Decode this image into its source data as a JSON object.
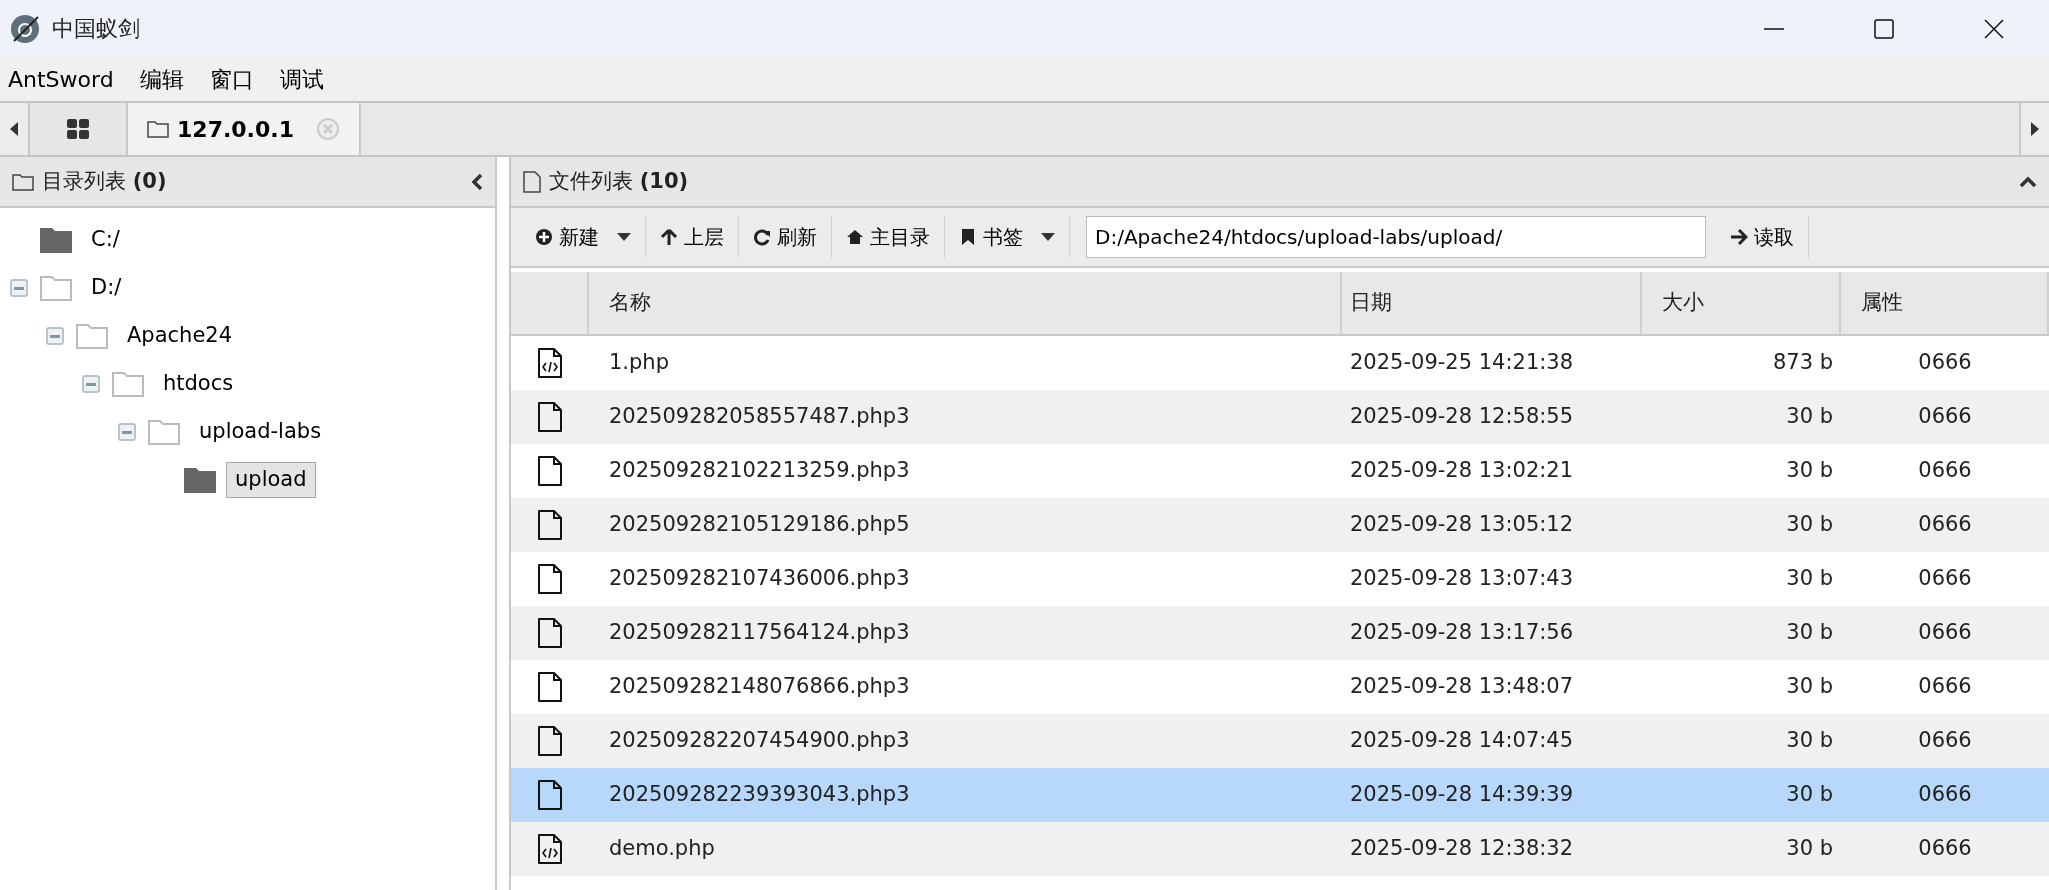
{
  "window": {
    "title": "中国蚁剑"
  },
  "menu": [
    "AntSword",
    "编辑",
    "窗口",
    "调试"
  ],
  "tabs": [
    {
      "kind": "home",
      "selected": false
    },
    {
      "kind": "folder",
      "label": "127.0.0.1",
      "selected": true
    }
  ],
  "dir_panel": {
    "title": "目录列表",
    "count": "(0)",
    "tree": [
      {
        "label": "C:/",
        "expanded": false,
        "selected": false
      },
      {
        "label": "D:/",
        "expanded": true,
        "selected": false,
        "children": [
          {
            "label": "Apache24",
            "expanded": true,
            "selected": false,
            "children": [
              {
                "label": "htdocs",
                "expanded": true,
                "selected": false,
                "children": [
                  {
                    "label": "upload-labs",
                    "expanded": true,
                    "selected": false,
                    "children": [
                      {
                        "label": "upload",
                        "expanded": false,
                        "selected": true
                      }
                    ]
                  }
                ]
              }
            ]
          }
        ]
      }
    ]
  },
  "file_panel": {
    "title": "文件列表",
    "count": "(10)",
    "toolbar": [
      {
        "kind": "new",
        "label": "新建",
        "dropdown": true
      },
      {
        "kind": "up",
        "label": "上层",
        "dropdown": false
      },
      {
        "kind": "refresh",
        "label": "刷新",
        "dropdown": false
      },
      {
        "kind": "home",
        "label": "主目录",
        "dropdown": false
      },
      {
        "kind": "bookmark",
        "label": "书签",
        "dropdown": true
      }
    ],
    "path": "D:/Apache24/htdocs/upload-labs/upload/",
    "read_button": "读取",
    "columns": [
      "名称",
      "日期",
      "大小",
      "属性"
    ],
    "rows": [
      {
        "kind": "code",
        "name": "1.php",
        "date": "2025-09-25 14:21:38",
        "size": "873 b",
        "attr": "0666",
        "selected": false
      },
      {
        "kind": "file",
        "name": "202509282058557487.php3",
        "date": "2025-09-28 12:58:55",
        "size": "30 b",
        "attr": "0666",
        "selected": false
      },
      {
        "kind": "file",
        "name": "202509282102213259.php3",
        "date": "2025-09-28 13:02:21",
        "size": "30 b",
        "attr": "0666",
        "selected": false
      },
      {
        "kind": "file",
        "name": "202509282105129186.php5",
        "date": "2025-09-28 13:05:12",
        "size": "30 b",
        "attr": "0666",
        "selected": false
      },
      {
        "kind": "file",
        "name": "202509282107436006.php3",
        "date": "2025-09-28 13:07:43",
        "size": "30 b",
        "attr": "0666",
        "selected": false
      },
      {
        "kind": "file",
        "name": "202509282117564124.php3",
        "date": "2025-09-28 13:17:56",
        "size": "30 b",
        "attr": "0666",
        "selected": false
      },
      {
        "kind": "file",
        "name": "202509282148076866.php3",
        "date": "2025-09-28 13:48:07",
        "size": "30 b",
        "attr": "0666",
        "selected": false
      },
      {
        "kind": "file",
        "name": "202509282207454900.php3",
        "date": "2025-09-28 14:07:45",
        "size": "30 b",
        "attr": "0666",
        "selected": false
      },
      {
        "kind": "file",
        "name": "202509282239393043.php3",
        "date": "2025-09-28 14:39:39",
        "size": "30 b",
        "attr": "0666",
        "selected": true
      },
      {
        "kind": "code",
        "name": "demo.php",
        "date": "2025-09-28 12:38:32",
        "size": "30 b",
        "attr": "0666",
        "selected": false
      }
    ]
  }
}
